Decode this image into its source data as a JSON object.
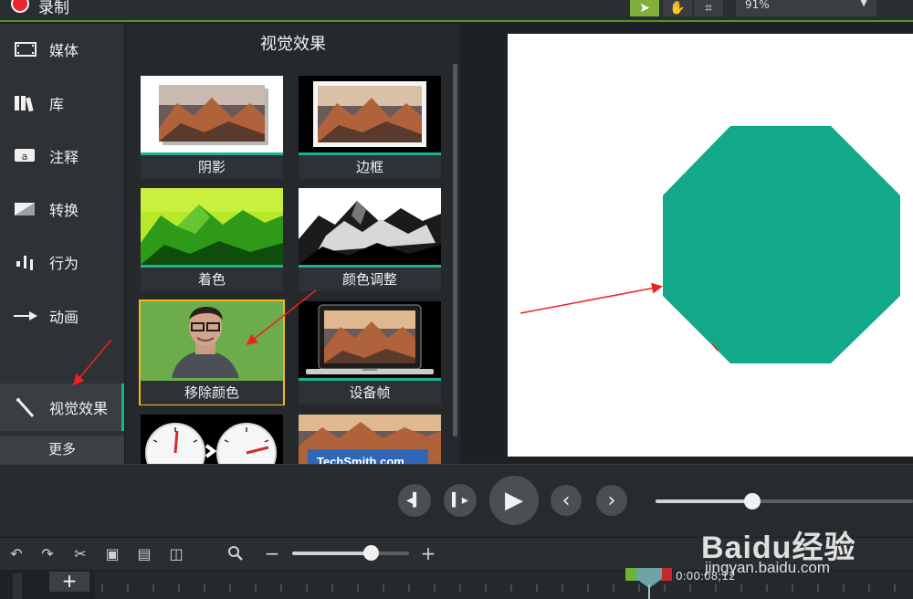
{
  "app": {
    "record_label": "录制"
  },
  "toolbar": {
    "tools": [
      {
        "name": "select",
        "icon": "cursor-arrow-icon",
        "glyph": "➤"
      },
      {
        "name": "pan",
        "icon": "hand-icon",
        "glyph": "✋"
      },
      {
        "name": "crop",
        "icon": "crop-icon",
        "glyph": "⌗"
      }
    ],
    "zoom_value": "91%",
    "accent_color": "#7fb03a"
  },
  "sidebar": {
    "items": [
      {
        "label": "媒体",
        "icon": "film-strip-icon",
        "glyph": "▤"
      },
      {
        "label": "库",
        "icon": "library-books-icon",
        "glyph": "▥"
      },
      {
        "label": "注释",
        "icon": "annotation-callout-icon",
        "glyph": "▭"
      },
      {
        "label": "转换",
        "icon": "transition-icon",
        "glyph": "◩"
      },
      {
        "label": "行为",
        "icon": "behavior-icon",
        "glyph": "⋮"
      },
      {
        "label": "动画",
        "icon": "animation-arrow-icon",
        "glyph": "→"
      },
      {
        "label": "视觉效果",
        "icon": "magic-wand-icon",
        "glyph": "⚚"
      }
    ],
    "more_label": "更多",
    "selected_index": 6
  },
  "effects_panel": {
    "title": "视觉效果",
    "tiles": [
      {
        "label": "阴影",
        "kind": "shadow"
      },
      {
        "label": "边框",
        "kind": "border"
      },
      {
        "label": "着色",
        "kind": "colorize"
      },
      {
        "label": "颜色调整",
        "kind": "color-adjust"
      },
      {
        "label": "移除颜色",
        "kind": "remove-color",
        "selected": true
      },
      {
        "label": "设备帧",
        "kind": "device-frame"
      },
      {
        "label": "",
        "kind": "gauges"
      },
      {
        "label": "",
        "kind": "techsmith"
      }
    ],
    "partial_tile_text": "TechSmith.com",
    "selected_outline_color": "#f2b81d",
    "accent_color": "#1fb08f"
  },
  "canvas": {
    "shape": "octagon",
    "shape_color": "#12a98a"
  },
  "playback": {
    "buttons": [
      {
        "name": "step-back",
        "icon": "step-back-icon",
        "glyph": "◂▍"
      },
      {
        "name": "step-forward",
        "icon": "step-forward-icon",
        "glyph": "▍▸"
      },
      {
        "name": "play",
        "icon": "play-icon",
        "glyph": "▶"
      },
      {
        "name": "previous",
        "icon": "chevron-left-icon",
        "glyph": "‹"
      },
      {
        "name": "next",
        "icon": "chevron-right-icon",
        "glyph": "›"
      }
    ],
    "seek_position": 0.38
  },
  "timeline": {
    "tools": [
      {
        "icon": "undo-icon",
        "glyph": "↶"
      },
      {
        "icon": "redo-icon",
        "glyph": "↷"
      },
      {
        "icon": "cut-icon",
        "glyph": "✂"
      },
      {
        "icon": "copy-icon",
        "glyph": "▣"
      },
      {
        "icon": "paste-icon",
        "glyph": "▤"
      },
      {
        "icon": "split-icon",
        "glyph": "◫"
      }
    ],
    "zoom_icon": "🔍",
    "zoom_minus": "−",
    "zoom_plus": "+",
    "zoom_level": 0.67,
    "add_track": "+",
    "playhead_time": "0:00:08;12"
  },
  "watermark": {
    "brand": "Baidu经验",
    "url": "jingyan.baidu.com"
  }
}
